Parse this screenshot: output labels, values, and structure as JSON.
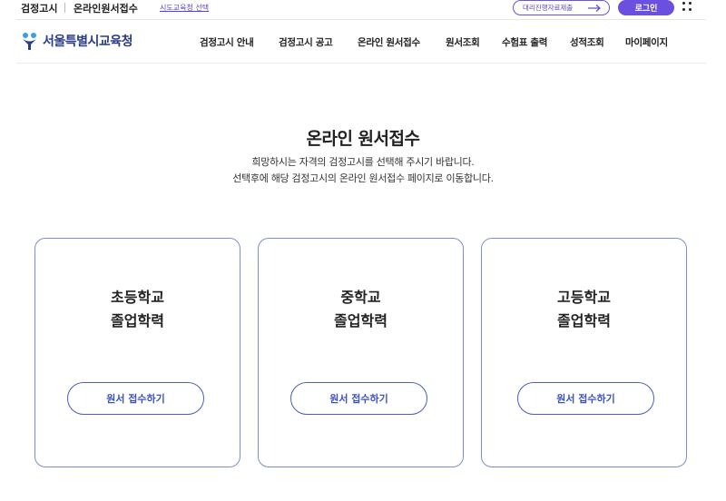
{
  "topbar": {
    "site_link": "검정고시",
    "online_link": "온라인원서접수",
    "office_select": "시도교육청 선택",
    "proxy_submit": "대리진행자료제출",
    "login": "로그인"
  },
  "header": {
    "logo_text": "서울특별시교육청",
    "nav": [
      "검정고시 안내",
      "검정고시 공고",
      "온라인 원서접수",
      "원서조회",
      "수험표 출력",
      "성적조회",
      "마이페이지"
    ]
  },
  "main": {
    "title": "온라인 원서접수",
    "desc_line1": "희망하시는 자격의 검정고시를 선택해 주시기 바랍니다.",
    "desc_line2": "선택후에 해당 검정고시의 온라인 원서접수 페이지로 이동합니다."
  },
  "cards": [
    {
      "line1": "초등학교",
      "line2": "졸업학력",
      "button": "원서 접수하기"
    },
    {
      "line1": "중학교",
      "line2": "졸업학력",
      "button": "원서 접수하기"
    },
    {
      "line1": "고등학교",
      "line2": "졸업학력",
      "button": "원서 접수하기"
    }
  ],
  "colors": {
    "accent": "#6b4fe0",
    "logo": "#2a3c88",
    "card_border": "#7b8fd0",
    "button_text": "#3b52c4"
  }
}
